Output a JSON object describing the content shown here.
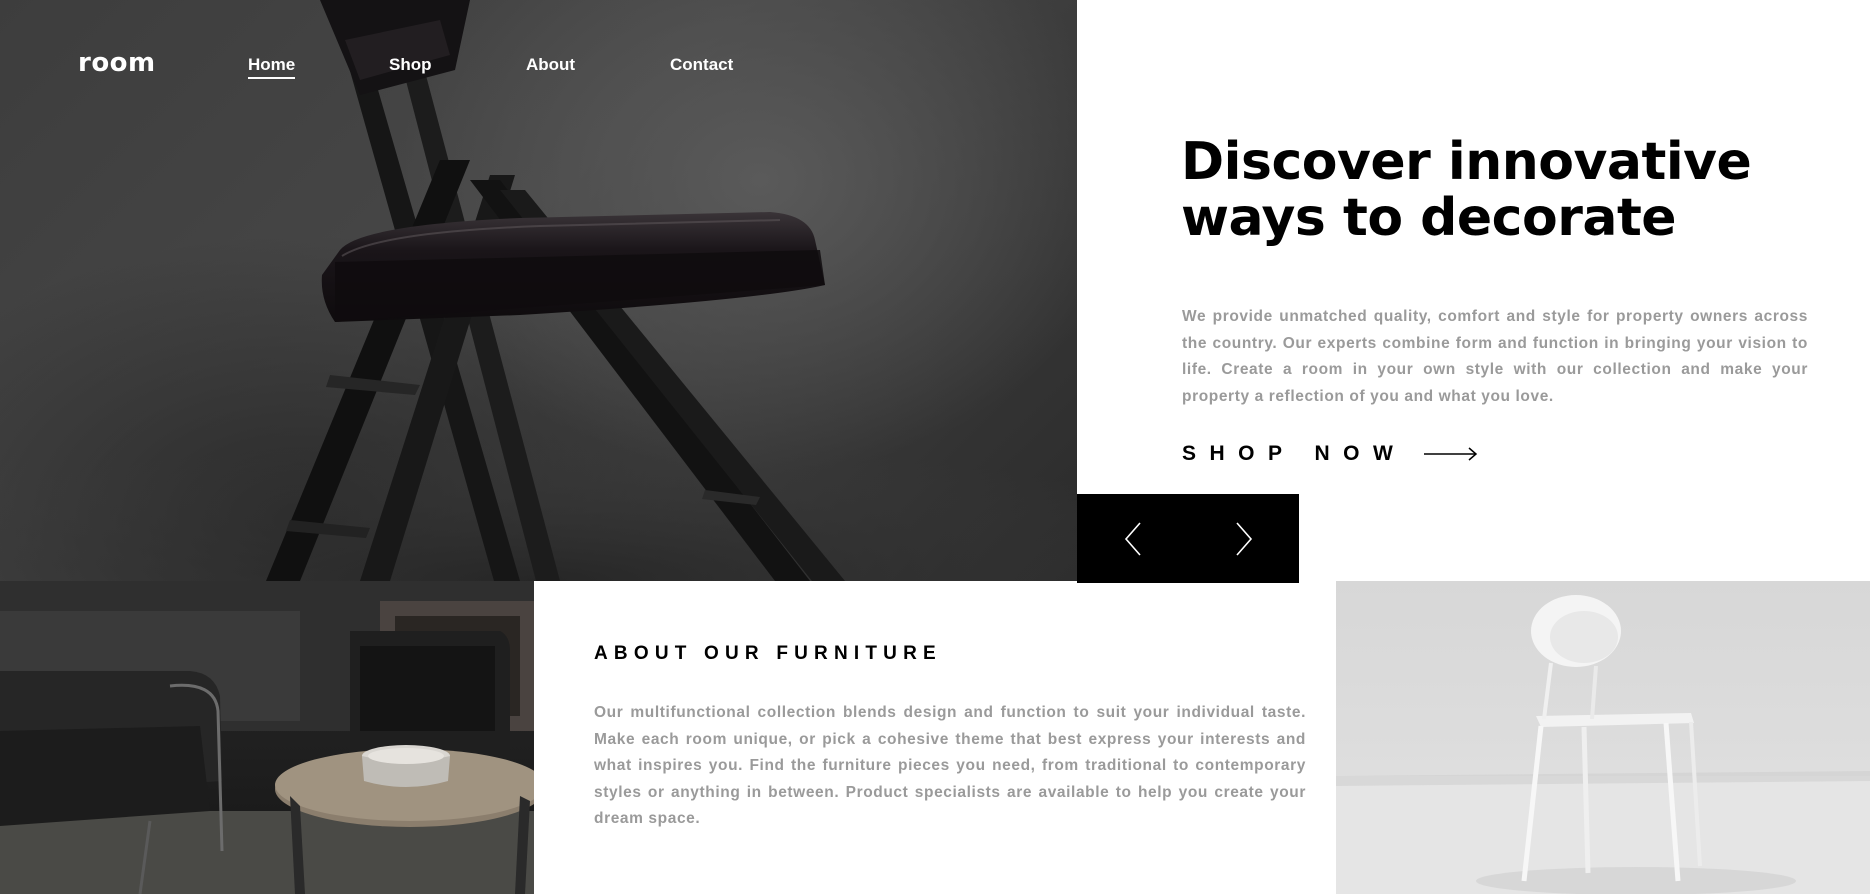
{
  "brand": {
    "logo": "room"
  },
  "nav": {
    "items": [
      {
        "label": "Home",
        "active": true
      },
      {
        "label": "Shop",
        "active": false
      },
      {
        "label": "About",
        "active": false
      },
      {
        "label": "Contact",
        "active": false
      }
    ]
  },
  "hero": {
    "title": "Discover innovative ways to decorate",
    "text": "We provide unmatched quality, comfort and style for property owners across the country. Our experts combine form and function in bringing your vision to life. Create a room in your own style with our collection and make your property a reflection of you and what you love.",
    "cta_label": "SHOP NOW",
    "image": "folding-chair-photo"
  },
  "slider": {
    "prev_icon": "chevron-left-icon",
    "next_icon": "chevron-right-icon"
  },
  "about": {
    "title": "ABOUT OUR FURNITURE",
    "text": "Our multifunctional collection blends design and function to suit your individual taste. Make each room unique, or pick a cohesive theme that best express your interests and what inspires you. Find the furniture pieces you need, from traditional to contemporary styles or anything in between. Product specialists are available to help you create your dream space.",
    "image_left": "dark-living-room-photo",
    "image_right": "white-chair-photo"
  },
  "colors": {
    "text_dark": "#000000",
    "text_muted": "#9a9a9a",
    "background": "#ffffff",
    "control_bg": "#000000"
  }
}
